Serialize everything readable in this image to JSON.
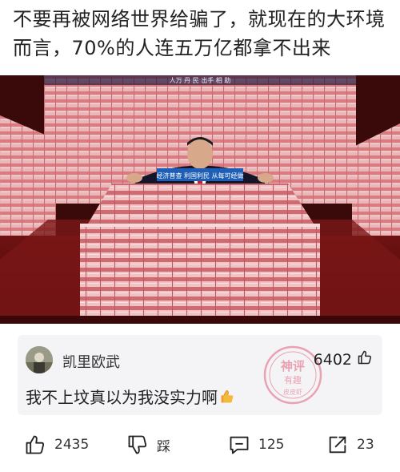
{
  "post": {
    "title": "不要再被网络世界给骗了，就现在的大环境而言，70%的人连五万亿都拿不出来"
  },
  "photo": {
    "desk_banner": "经济普查  利国利民  从每可经做",
    "top_banner": "人万 丹 民 出手 相 助"
  },
  "comment": {
    "username": "凯里欧武",
    "likes": "6402",
    "text": "我不上坟真以为我没实力啊",
    "stamp_top": "神评",
    "stamp_mid": "有趣",
    "stamp_bottom": "皮皮虾"
  },
  "actions": {
    "like_count": "2435",
    "dislike_label": "踩",
    "comment_count": "125",
    "share_count": "23"
  },
  "colors": {
    "stamp": "#e0607a",
    "money_pink": "#e8a4a8",
    "money_red": "#c8585f",
    "carpet": "#8a1a1a",
    "banner_blue": "#1e5fb5"
  }
}
